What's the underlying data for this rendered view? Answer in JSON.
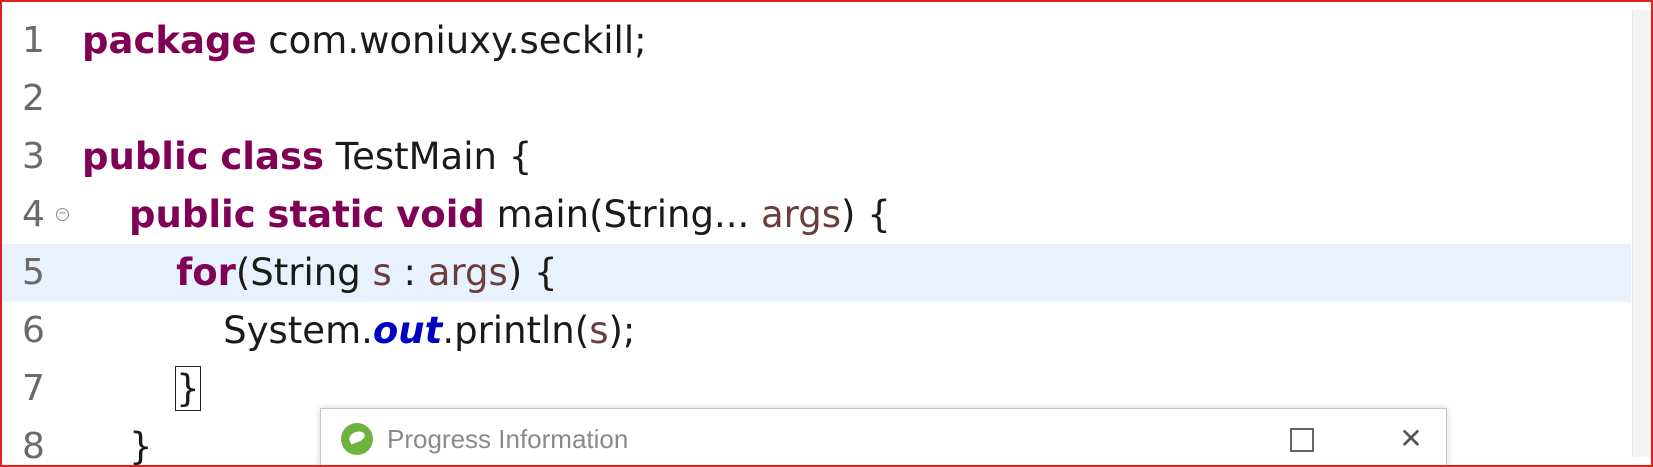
{
  "editor": {
    "lines": [
      {
        "num": "1",
        "tokens": [
          {
            "t": "package",
            "c": "kw"
          },
          {
            "t": " com.woniuxy.seckill;",
            "c": ""
          }
        ]
      },
      {
        "num": "2",
        "tokens": []
      },
      {
        "num": "3",
        "tokens": [
          {
            "t": "public",
            "c": "kw"
          },
          {
            "t": " ",
            "c": ""
          },
          {
            "t": "class",
            "c": "kw"
          },
          {
            "t": " TestMain {",
            "c": ""
          }
        ]
      },
      {
        "num": "4",
        "fold": true,
        "tokens": [
          {
            "t": "    ",
            "c": ""
          },
          {
            "t": "public",
            "c": "kw"
          },
          {
            "t": " ",
            "c": ""
          },
          {
            "t": "static",
            "c": "kw"
          },
          {
            "t": " ",
            "c": ""
          },
          {
            "t": "void",
            "c": "kw"
          },
          {
            "t": " main(String... ",
            "c": ""
          },
          {
            "t": "args",
            "c": "var"
          },
          {
            "t": ") {",
            "c": ""
          }
        ]
      },
      {
        "num": "5",
        "current": true,
        "tokens": [
          {
            "t": "        ",
            "c": ""
          },
          {
            "t": "for",
            "c": "kw"
          },
          {
            "t": "(String ",
            "c": ""
          },
          {
            "t": "s",
            "c": "var"
          },
          {
            "t": " : ",
            "c": ""
          },
          {
            "t": "args",
            "c": "var"
          },
          {
            "t": ") {",
            "c": ""
          }
        ]
      },
      {
        "num": "6",
        "tokens": [
          {
            "t": "            System.",
            "c": ""
          },
          {
            "t": "out",
            "c": "fld"
          },
          {
            "t": ".println(",
            "c": ""
          },
          {
            "t": "s",
            "c": "var"
          },
          {
            "t": ");",
            "c": ""
          }
        ]
      },
      {
        "num": "7",
        "tokens": [
          {
            "t": "        ",
            "c": ""
          },
          {
            "t": "}",
            "c": "bm"
          }
        ]
      },
      {
        "num": "8",
        "tokens": [
          {
            "t": "    }",
            "c": ""
          }
        ]
      }
    ]
  },
  "dialog": {
    "title": "Progress Information",
    "icon": "spring-leaf-icon",
    "maximize_icon": "maximize-icon",
    "close_glyph": "✕"
  }
}
